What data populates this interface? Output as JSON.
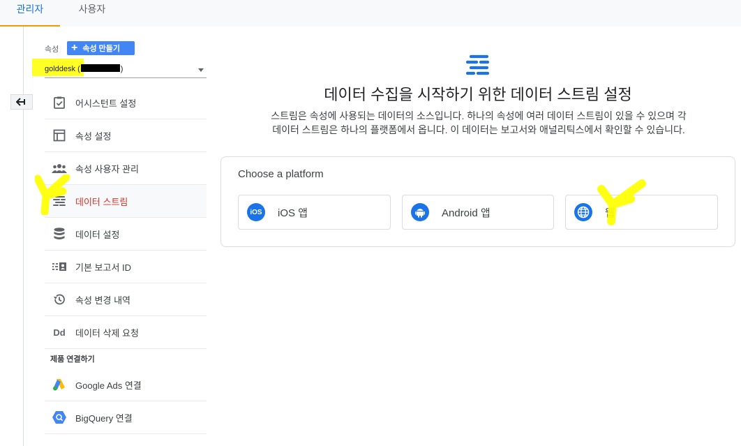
{
  "tabs": {
    "admin": "관리자",
    "user": "사용자"
  },
  "property": {
    "label": "속성",
    "create_button": "속성 만들기",
    "selected_name": "golddesk (",
    "selected_suffix": ")"
  },
  "nav": {
    "items": [
      {
        "label": "어시스턴트 설정",
        "icon": "clipboard-check-icon"
      },
      {
        "label": "속성 설정",
        "icon": "layout-icon"
      },
      {
        "label": "속성 사용자 관리",
        "icon": "people-icon"
      },
      {
        "label": "데이터 스트림",
        "icon": "data-stream-icon",
        "active": true
      },
      {
        "label": "데이터 설정",
        "icon": "database-icon"
      },
      {
        "label": "기본 보고서 ID",
        "icon": "id-card-icon"
      },
      {
        "label": "속성 변경 내역",
        "icon": "history-icon"
      },
      {
        "label": "데이터 삭제 요청",
        "icon": "dd-icon"
      }
    ],
    "section_title": "제품 연결하기",
    "links": [
      {
        "label": "Google Ads 연결",
        "icon": "google-ads-icon"
      },
      {
        "label": "BigQuery 연결",
        "icon": "bigquery-icon"
      }
    ]
  },
  "main": {
    "title": "데이터 수집을 시작하기 위한 데이터 스트림 설정",
    "desc_line1": "스트림은 속성에 사용되는 데이터의 소스입니다. 하나의 속성에 여러 데이터 스트림이 있을 수 있으며 각",
    "desc_line2": "데이터 스트림은 하나의 플랫폼에서 옵니다. 이 데이터는 보고서와 애널리틱스에서 확인할 수 있습니다.",
    "platform_title": "Choose a platform",
    "platforms": [
      {
        "label": "iOS 앱",
        "icon": "ios-icon",
        "icon_text": "iOS"
      },
      {
        "label": "Android 앱",
        "icon": "android-icon"
      },
      {
        "label": "웹",
        "icon": "globe-icon"
      }
    ]
  },
  "colors": {
    "accent": "#1a73e8",
    "active_red": "#d93025",
    "tab_underline": "#f29900",
    "highlight": "#ffff00"
  }
}
